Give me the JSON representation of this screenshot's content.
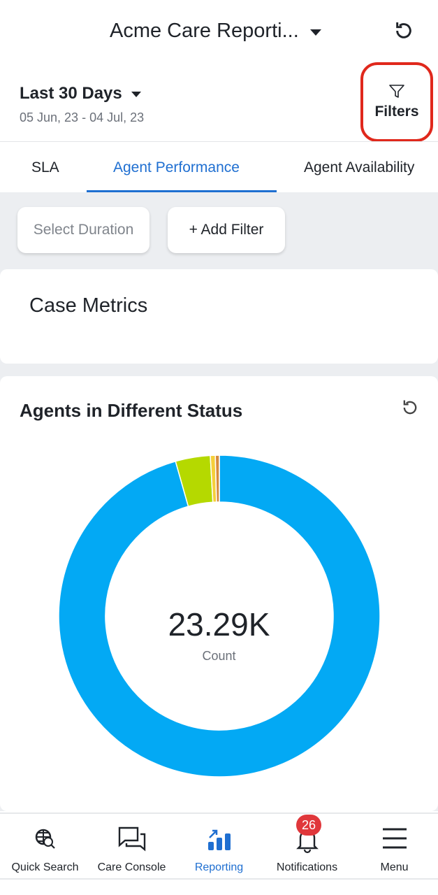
{
  "header": {
    "title": "Acme Care Reporti...",
    "refresh_icon": "refresh-icon"
  },
  "date_range": {
    "label": "Last 30 Days",
    "dates": "05 Jun, 23 - 04 Jul, 23"
  },
  "filters": {
    "label": "Filters",
    "icon": "funnel-icon",
    "highlight_color": "#e0281c"
  },
  "tabs": [
    {
      "label": "SLA"
    },
    {
      "label": "Agent Performance",
      "active": true
    },
    {
      "label": "Agent Availability"
    }
  ],
  "chips": {
    "duration_placeholder": "Select Duration",
    "add_filter": "+ Add Filter"
  },
  "case_metrics": {
    "title": "Case Metrics"
  },
  "status_card": {
    "title": "Agents in Different Status",
    "center_value": "23.29K",
    "center_label": "Count"
  },
  "chart_data": {
    "type": "pie",
    "donut": true,
    "total_label": "23.29K",
    "series": [
      {
        "color": "#03a9f4",
        "share_percent": 95.6
      },
      {
        "color": "#b5d900",
        "share_percent": 3.5
      },
      {
        "color": "#f5cf3a",
        "share_percent": 0.5
      },
      {
        "color": "#d68a3c",
        "share_percent": 0.4
      }
    ]
  },
  "bottom_nav": [
    {
      "label": "Quick Search",
      "icon": "globe-search-icon"
    },
    {
      "label": "Care Console",
      "icon": "chat-bubbles-icon"
    },
    {
      "label": "Reporting",
      "icon": "bar-chart-icon",
      "active": true
    },
    {
      "label": "Notifications",
      "icon": "bell-icon",
      "badge": "26"
    },
    {
      "label": "Menu",
      "icon": "hamburger-icon"
    }
  ],
  "colors": {
    "accent": "#1f6fd1",
    "badge": "#e0373b"
  }
}
